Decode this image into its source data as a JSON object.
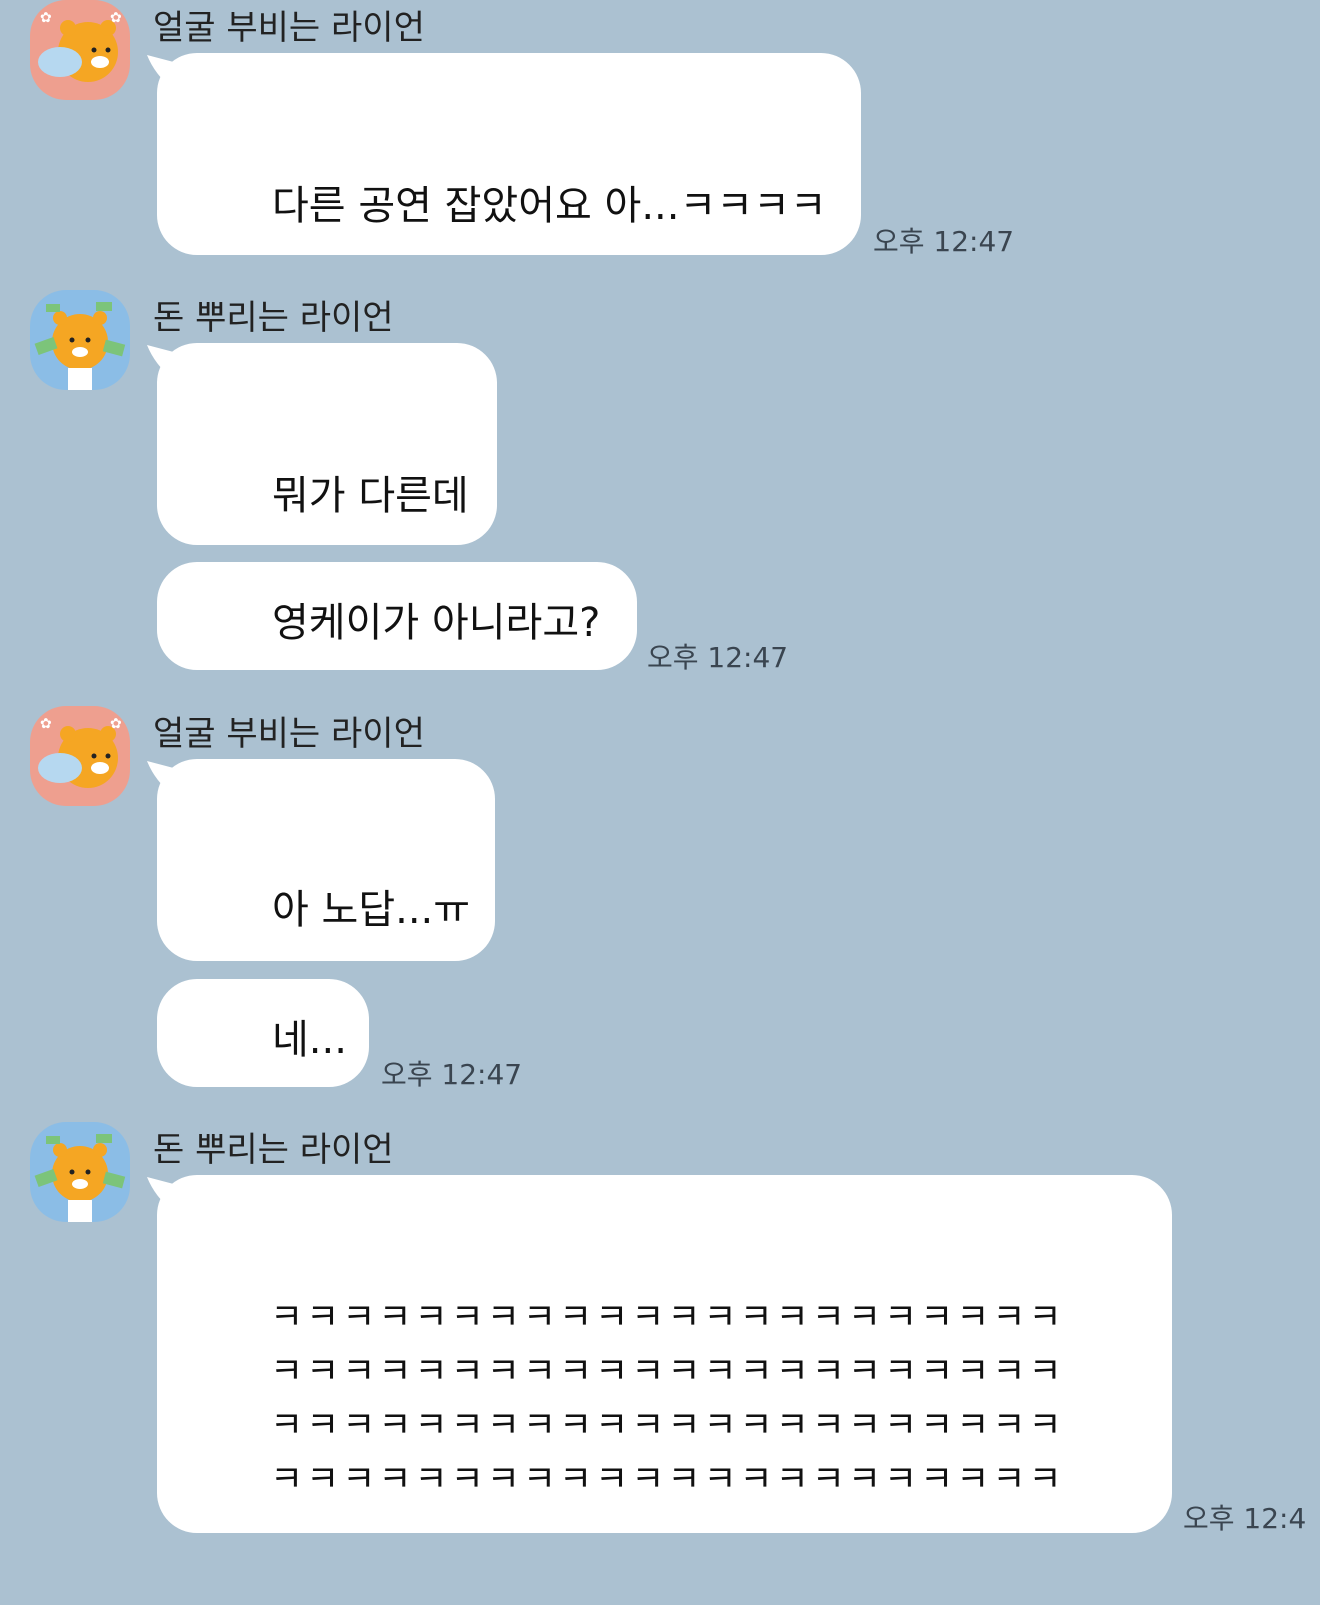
{
  "chat": {
    "participants": {
      "face_pillow_ryan": {
        "name": "얼굴 부비는 라이언",
        "avatar_icon": "ryan-hugging-pillow-icon",
        "avatar_bg": "#ee9f8f"
      },
      "money_ryan": {
        "name": "돈 뿌리는 라이언",
        "avatar_icon": "ryan-throwing-money-icon",
        "avatar_bg": "#8bbde6"
      }
    },
    "groups": [
      {
        "sender": "얼굴 부비는 라이언",
        "messages": [
          {
            "text": "다른 공연 잡았어요 아...ㅋㅋㅋㅋ",
            "time": "오후 12:47"
          }
        ]
      },
      {
        "sender": "돈 뿌리는 라이언",
        "messages": [
          {
            "text": "뭐가 다른데",
            "time": ""
          },
          {
            "text": "영케이가 아니라고?",
            "time": "오후 12:47"
          }
        ]
      },
      {
        "sender": "얼굴 부비는 라이언",
        "messages": [
          {
            "text": "아 노답...ㅠ",
            "time": ""
          },
          {
            "text": "네...",
            "time": "오후 12:47"
          }
        ]
      },
      {
        "sender": "돈 뿌리는 라이언",
        "messages": [
          {
            "text": "ㅋㅋㅋㅋㅋㅋㅋㅋㅋㅋㅋㅋㅋㅋㅋㅋㅋㅋㅋㅋㅋㅋㅋㅋㅋㅋㅋㅋㅋㅋㅋㅋㅋㅋㅋㅋㅋㅋㅋㅋㅋㅋㅋㅋㅋㅋㅋㅋㅋㅋㅋㅋㅋㅋㅋㅋㅋㅋㅋㅋㅋㅋㅋㅋㅋㅋㅋㅋㅋㅋㅋㅋㅋㅋㅋㅋㅋㅋㅋㅋㅋㅋㅋㅋㅋㅋㅋㅋ",
            "lines": [
              "ㅋㅋㅋㅋㅋㅋㅋㅋㅋㅋㅋㅋㅋㅋㅋㅋㅋㅋㅋㅋㅋㅋ",
              "ㅋㅋㅋㅋㅋㅋㅋㅋㅋㅋㅋㅋㅋㅋㅋㅋㅋㅋㅋㅋㅋㅋ",
              "ㅋㅋㅋㅋㅋㅋㅋㅋㅋㅋㅋㅋㅋㅋㅋㅋㅋㅋㅋㅋㅋㅋ",
              "ㅋㅋㅋㅋㅋㅋㅋㅋㅋㅋㅋㅋㅋㅋㅋㅋㅋㅋㅋㅋㅋㅋ"
            ],
            "time": "오후 12:4"
          }
        ]
      }
    ],
    "colors": {
      "background": "#abc1d1",
      "bubble": "#ffffff",
      "text": "#111111",
      "time": "#3a4550"
    }
  }
}
